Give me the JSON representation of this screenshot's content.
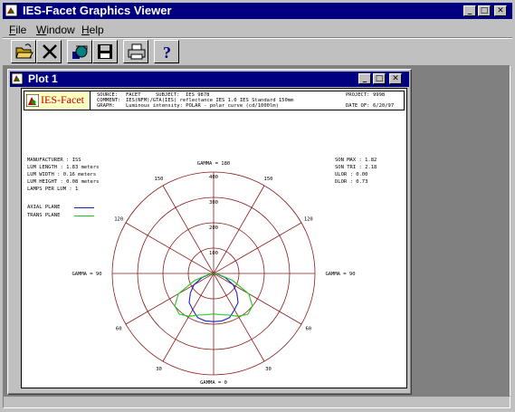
{
  "app": {
    "title": "IES-Facet Graphics Viewer"
  },
  "menu": [
    {
      "label": "File",
      "accel": "F",
      "rest": "ile"
    },
    {
      "label": "Window",
      "accel": "W",
      "rest": "indow"
    },
    {
      "label": "Help",
      "accel": "H",
      "rest": "elp"
    }
  ],
  "toolbar": [
    {
      "name": "open-icon"
    },
    {
      "name": "close-x-icon"
    },
    {
      "name": "graph-icon"
    },
    {
      "name": "save-icon"
    },
    {
      "name": "print-icon"
    },
    {
      "name": "help-icon"
    }
  ],
  "plot_window": {
    "title": "Plot 1"
  },
  "plot": {
    "logo": "IES-Facet",
    "header": {
      "r1_a": "SOURCE:",
      "r1_b": "FACET",
      "r1_c": "SUBJECT:",
      "r1_d": "IES 9878",
      "r1_e": "PROJECT:",
      "r1_f": "9998",
      "r2_a": "COMMENT:",
      "r2_b": "IES(NFM)/GTA(IES) reflectance IES 1.0 IES Standard 150mm",
      "r3_a": "GRAPH:",
      "r3_b": "Luminous intensity: POLAR - polar curve (cd/1000lm)",
      "r3_c": "DATE OF:",
      "r3_d": "6/20/97"
    },
    "left_info": [
      {
        "k": "MANUFACTURER",
        "v": "   ISS"
      },
      {
        "k": "LUM LENGTH  ",
        "v": "   1.83 meters"
      },
      {
        "k": "LUM WIDTH   ",
        "v": "   0.16 meters"
      },
      {
        "k": "LUM HEIGHT  ",
        "v": "   0.08 meters"
      },
      {
        "k": "LAMPS PER LUM",
        "v": "  1"
      }
    ],
    "right_info": [
      {
        "k": "SON MAX",
        "v": "1.82"
      },
      {
        "k": "SON TRI",
        "v": "2.18"
      },
      {
        "k": "ULOR   ",
        "v": "0.00"
      },
      {
        "k": "DLOR   ",
        "v": "0.73"
      }
    ],
    "legend": [
      {
        "label": "AXIAL PLANE",
        "color": "#1e1ec8"
      },
      {
        "label": "TRANS PLANE",
        "color": "#1ec81e"
      }
    ],
    "gamma_labels": {
      "top": "GAMMA = 180",
      "bottom": "GAMMA = 0",
      "left": "GAMMA = 90",
      "right": "GAMMA = 90"
    },
    "angle_labels": [
      "150",
      "150",
      "120",
      "120",
      "60",
      "60",
      "30",
      "30"
    ],
    "ring_labels": [
      "400",
      "300",
      "200",
      "100"
    ]
  },
  "chart_data": {
    "type": "polar",
    "title": "",
    "radial_ticks": [
      100,
      200,
      300,
      400
    ],
    "angular_ticks_deg": [
      0,
      30,
      60,
      90,
      120,
      150,
      180
    ],
    "series": [
      {
        "name": "AXIAL PLANE",
        "color": "#1e1ec8",
        "gamma_deg": [
          0,
          10,
          20,
          30,
          40,
          50,
          60,
          70,
          80,
          90
        ],
        "values": [
          190,
          190,
          185,
          165,
          150,
          120,
          90,
          50,
          15,
          0
        ]
      },
      {
        "name": "TRANS PLANE",
        "color": "#1ec81e",
        "gamma_deg": [
          0,
          10,
          20,
          30,
          40,
          50,
          60,
          70,
          80,
          90
        ],
        "values": [
          160,
          165,
          175,
          195,
          210,
          200,
          160,
          80,
          20,
          0
        ]
      }
    ]
  },
  "colors": {
    "titlebar": "#000080",
    "desktop": "#c0c0c0",
    "grid": "#8b1a1a"
  }
}
